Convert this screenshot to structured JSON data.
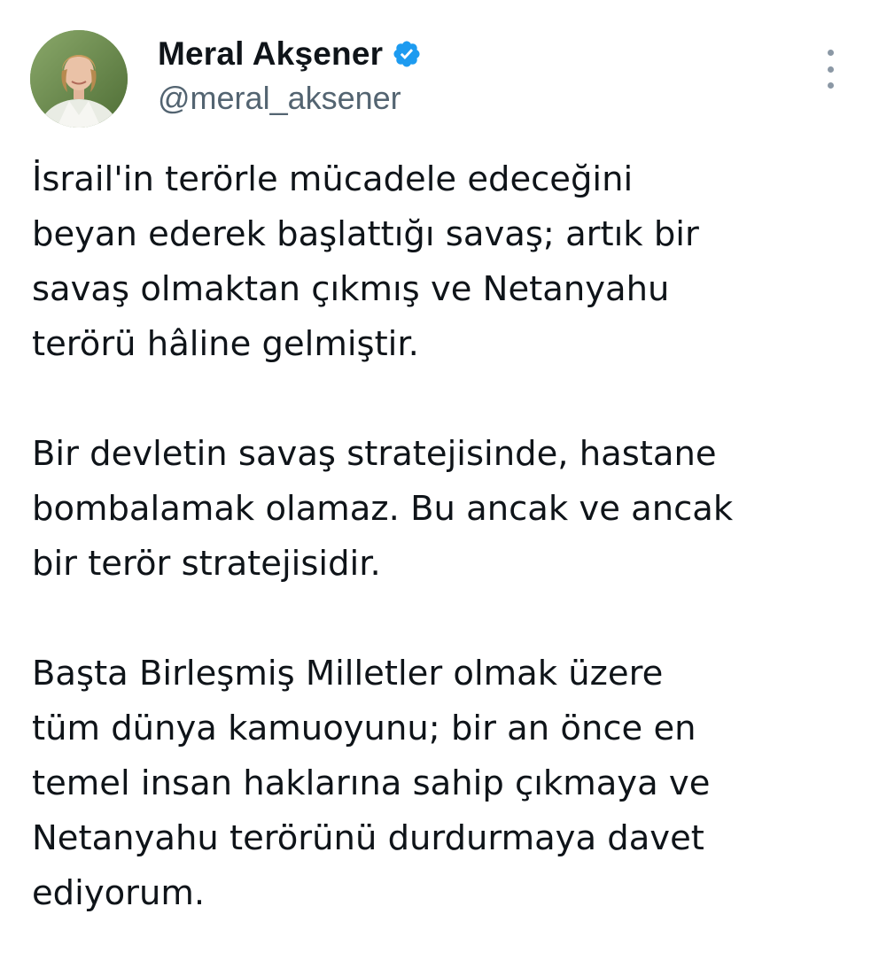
{
  "author": {
    "display_name": "Meral Akşener",
    "handle": "@meral_aksener",
    "verified_icon": "verified-badge-icon",
    "verified_color": "#1d9bf0"
  },
  "menu": {
    "icon": "more-vertical-icon"
  },
  "tweet": {
    "paragraphs": [
      {
        "lines": [
          "İsrail'in terörle mücadele edeceğini",
          "beyan ederek başlattığı savaş; artık bir",
          "savaş olmaktan çıkmış ve Netanyahu",
          "terörü hâline gelmiştir."
        ]
      },
      {
        "lines": [
          "Bir devletin savaş stratejisinde, hastane",
          "bombalamak olamaz. Bu ancak ve ancak",
          "bir terör stratejisidir."
        ]
      },
      {
        "lines": [
          "Başta Birleşmiş Milletler olmak üzere",
          "tüm dünya kamuoyunu; bir an önce en",
          "temel insan haklarına sahip çıkmaya ve",
          "Netanyahu terörünü durdurmaya davet",
          "ediyorum."
        ]
      }
    ]
  },
  "colors": {
    "text": "#0f1419",
    "secondary_text": "#536471",
    "background": "#ffffff"
  }
}
